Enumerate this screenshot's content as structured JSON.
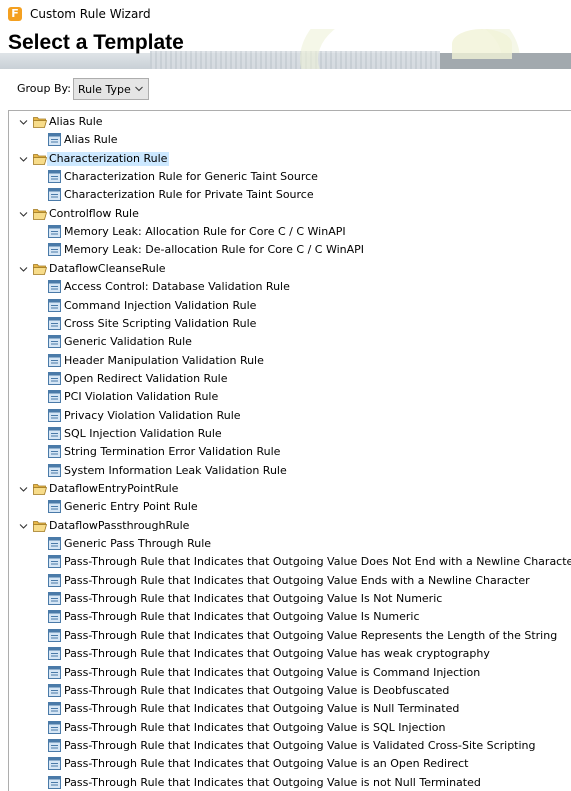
{
  "window": {
    "title": "Custom Rule Wizard",
    "app_icon_letter": "F"
  },
  "header": {
    "title": "Select a Template"
  },
  "group_by": {
    "label": "Group By:",
    "value": "Rule Type"
  },
  "tree": [
    {
      "type": "group",
      "label": "Alias Rule",
      "expanded": true,
      "selected": false
    },
    {
      "type": "item",
      "label": "Alias Rule"
    },
    {
      "type": "group",
      "label": "Characterization Rule",
      "expanded": true,
      "selected": true
    },
    {
      "type": "item",
      "label": "Characterization Rule for Generic Taint Source"
    },
    {
      "type": "item",
      "label": "Characterization Rule for Private Taint Source"
    },
    {
      "type": "group",
      "label": "Controlflow Rule",
      "expanded": true,
      "selected": false
    },
    {
      "type": "item",
      "label": "Memory Leak: Allocation Rule for Core C / C WinAPI"
    },
    {
      "type": "item",
      "label": "Memory Leak: De-allocation Rule for Core C / C WinAPI"
    },
    {
      "type": "group",
      "label": "DataflowCleanseRule",
      "expanded": true,
      "selected": false
    },
    {
      "type": "item",
      "label": "Access Control: Database Validation Rule"
    },
    {
      "type": "item",
      "label": "Command Injection Validation Rule"
    },
    {
      "type": "item",
      "label": "Cross Site Scripting Validation Rule"
    },
    {
      "type": "item",
      "label": "Generic Validation Rule"
    },
    {
      "type": "item",
      "label": "Header Manipulation Validation Rule"
    },
    {
      "type": "item",
      "label": "Open Redirect Validation Rule"
    },
    {
      "type": "item",
      "label": "PCI Violation Validation Rule"
    },
    {
      "type": "item",
      "label": "Privacy Violation Validation Rule"
    },
    {
      "type": "item",
      "label": "SQL Injection Validation Rule"
    },
    {
      "type": "item",
      "label": "String Termination Error Validation Rule"
    },
    {
      "type": "item",
      "label": "System Information Leak Validation Rule"
    },
    {
      "type": "group",
      "label": "DataflowEntryPointRule",
      "expanded": true,
      "selected": false
    },
    {
      "type": "item",
      "label": "Generic Entry Point Rule"
    },
    {
      "type": "group",
      "label": "DataflowPassthroughRule",
      "expanded": true,
      "selected": false
    },
    {
      "type": "item",
      "label": "Generic Pass Through Rule"
    },
    {
      "type": "item",
      "label": "Pass-Through Rule that Indicates that Outgoing Value Does Not End with a Newline Character"
    },
    {
      "type": "item",
      "label": "Pass-Through Rule that Indicates that Outgoing Value Ends with a Newline Character"
    },
    {
      "type": "item",
      "label": "Pass-Through Rule that Indicates that Outgoing Value Is Not Numeric"
    },
    {
      "type": "item",
      "label": "Pass-Through Rule that Indicates that Outgoing Value Is Numeric"
    },
    {
      "type": "item",
      "label": "Pass-Through Rule that Indicates that Outgoing Value Represents the Length of the String"
    },
    {
      "type": "item",
      "label": "Pass-Through Rule that Indicates that Outgoing Value has weak cryptography"
    },
    {
      "type": "item",
      "label": "Pass-Through Rule that Indicates that Outgoing Value is Command Injection"
    },
    {
      "type": "item",
      "label": "Pass-Through Rule that Indicates that Outgoing Value is Deobfuscated"
    },
    {
      "type": "item",
      "label": "Pass-Through Rule that Indicates that Outgoing Value is Null Terminated"
    },
    {
      "type": "item",
      "label": "Pass-Through Rule that Indicates that Outgoing Value is SQL Injection"
    },
    {
      "type": "item",
      "label": "Pass-Through Rule that Indicates that Outgoing Value is Validated Cross-Site Scripting"
    },
    {
      "type": "item",
      "label": "Pass-Through Rule that Indicates that Outgoing Value is an Open Redirect"
    },
    {
      "type": "item",
      "label": "Pass-Through Rule that Indicates that Outgoing Value is not Null Terminated"
    }
  ],
  "colors": {
    "selection": "#cce8ff",
    "folder": "#e8b84a",
    "app_icon": "#f4a020",
    "leaf_icon_border": "#4a7aa8",
    "leaf_icon_fill": "#d6e6f5"
  }
}
